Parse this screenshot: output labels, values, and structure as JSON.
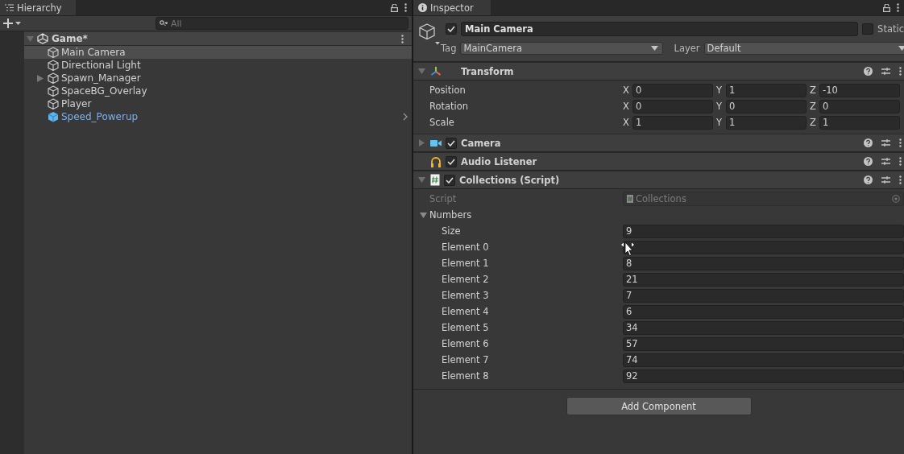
{
  "hierarchy": {
    "title": "Hierarchy",
    "search": {
      "placeholder": "All"
    },
    "scene": {
      "name": "Game*",
      "expanded": true,
      "children": [
        {
          "name": "Main Camera",
          "kind": "object",
          "selected": true
        },
        {
          "name": "Directional Light",
          "kind": "object",
          "selected": false
        },
        {
          "name": "Spawn_Manager",
          "kind": "folded",
          "selected": false
        },
        {
          "name": "SpaceBG_Overlay",
          "kind": "object",
          "selected": false
        },
        {
          "name": "Player",
          "kind": "object",
          "selected": false
        },
        {
          "name": "Speed_Powerup",
          "kind": "prefab",
          "selected": false
        }
      ]
    }
  },
  "inspector": {
    "title": "Inspector",
    "object": {
      "active": true,
      "name": "Main Camera",
      "static": {
        "label": "Static",
        "checked": false
      },
      "tag": {
        "label": "Tag",
        "value": "MainCamera"
      },
      "layer": {
        "label": "Layer",
        "value": "Default"
      }
    },
    "components": [
      {
        "name": "Transform",
        "kind": "transform",
        "expanded": true,
        "fields": [
          {
            "label": "Position",
            "values": [
              {
                "axis": "X",
                "value": "0"
              },
              {
                "axis": "Y",
                "value": "1"
              },
              {
                "axis": "Z",
                "value": "-10"
              }
            ]
          },
          {
            "label": "Rotation",
            "values": [
              {
                "axis": "X",
                "value": "0"
              },
              {
                "axis": "Y",
                "value": "0"
              },
              {
                "axis": "Z",
                "value": "0"
              }
            ]
          },
          {
            "label": "Scale",
            "values": [
              {
                "axis": "X",
                "value": "1"
              },
              {
                "axis": "Y",
                "value": "1"
              },
              {
                "axis": "Z",
                "value": "1"
              }
            ]
          }
        ]
      },
      {
        "name": "Camera",
        "kind": "camera",
        "expanded": false,
        "enabled": true
      },
      {
        "name": "Audio Listener",
        "kind": "audio",
        "enabled": true
      },
      {
        "name": "Collections (Script)",
        "kind": "script",
        "expanded": true,
        "enabled": true,
        "script": {
          "label": "Script",
          "value": "Collections"
        },
        "list": {
          "label": "Numbers",
          "expanded": true,
          "size": {
            "label": "Size",
            "value": "9"
          },
          "elements": [
            {
              "label": "Element 0"
            },
            {
              "label": "Element 1",
              "value": "8"
            },
            {
              "label": "Element 2",
              "value": "21"
            },
            {
              "label": "Element 3",
              "value": "7"
            },
            {
              "label": "Element 4",
              "value": "6"
            },
            {
              "label": "Element 5",
              "value": "34"
            },
            {
              "label": "Element 6",
              "value": "57"
            },
            {
              "label": "Element 7",
              "value": "74"
            },
            {
              "label": "Element 8",
              "value": "92"
            }
          ]
        }
      }
    ],
    "add_button": "Add Component"
  }
}
